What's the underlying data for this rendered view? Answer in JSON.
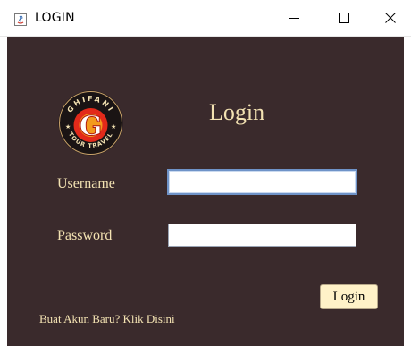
{
  "window": {
    "title": "LOGIN",
    "controls": {
      "minimize": "minimize-icon",
      "maximize": "maximize-icon",
      "close": "close-icon"
    }
  },
  "form": {
    "heading": "Login",
    "username_label": "Username",
    "username_value": "",
    "password_label": "Password",
    "password_value": "",
    "login_button": "Login",
    "register_link": "Buat Akun Baru? Klik Disini"
  },
  "logo": {
    "icon": "company-logo",
    "text_top": "GHIFANI",
    "text_bottom": "TOUR TRAVEL",
    "letter": "G"
  },
  "colors": {
    "panel_bg": "#3a2a2c",
    "label_text": "#f3e2b2",
    "button_bg": "#fff2c8",
    "logo_red": "#e32a1a",
    "logo_orange": "#f39a1e"
  }
}
